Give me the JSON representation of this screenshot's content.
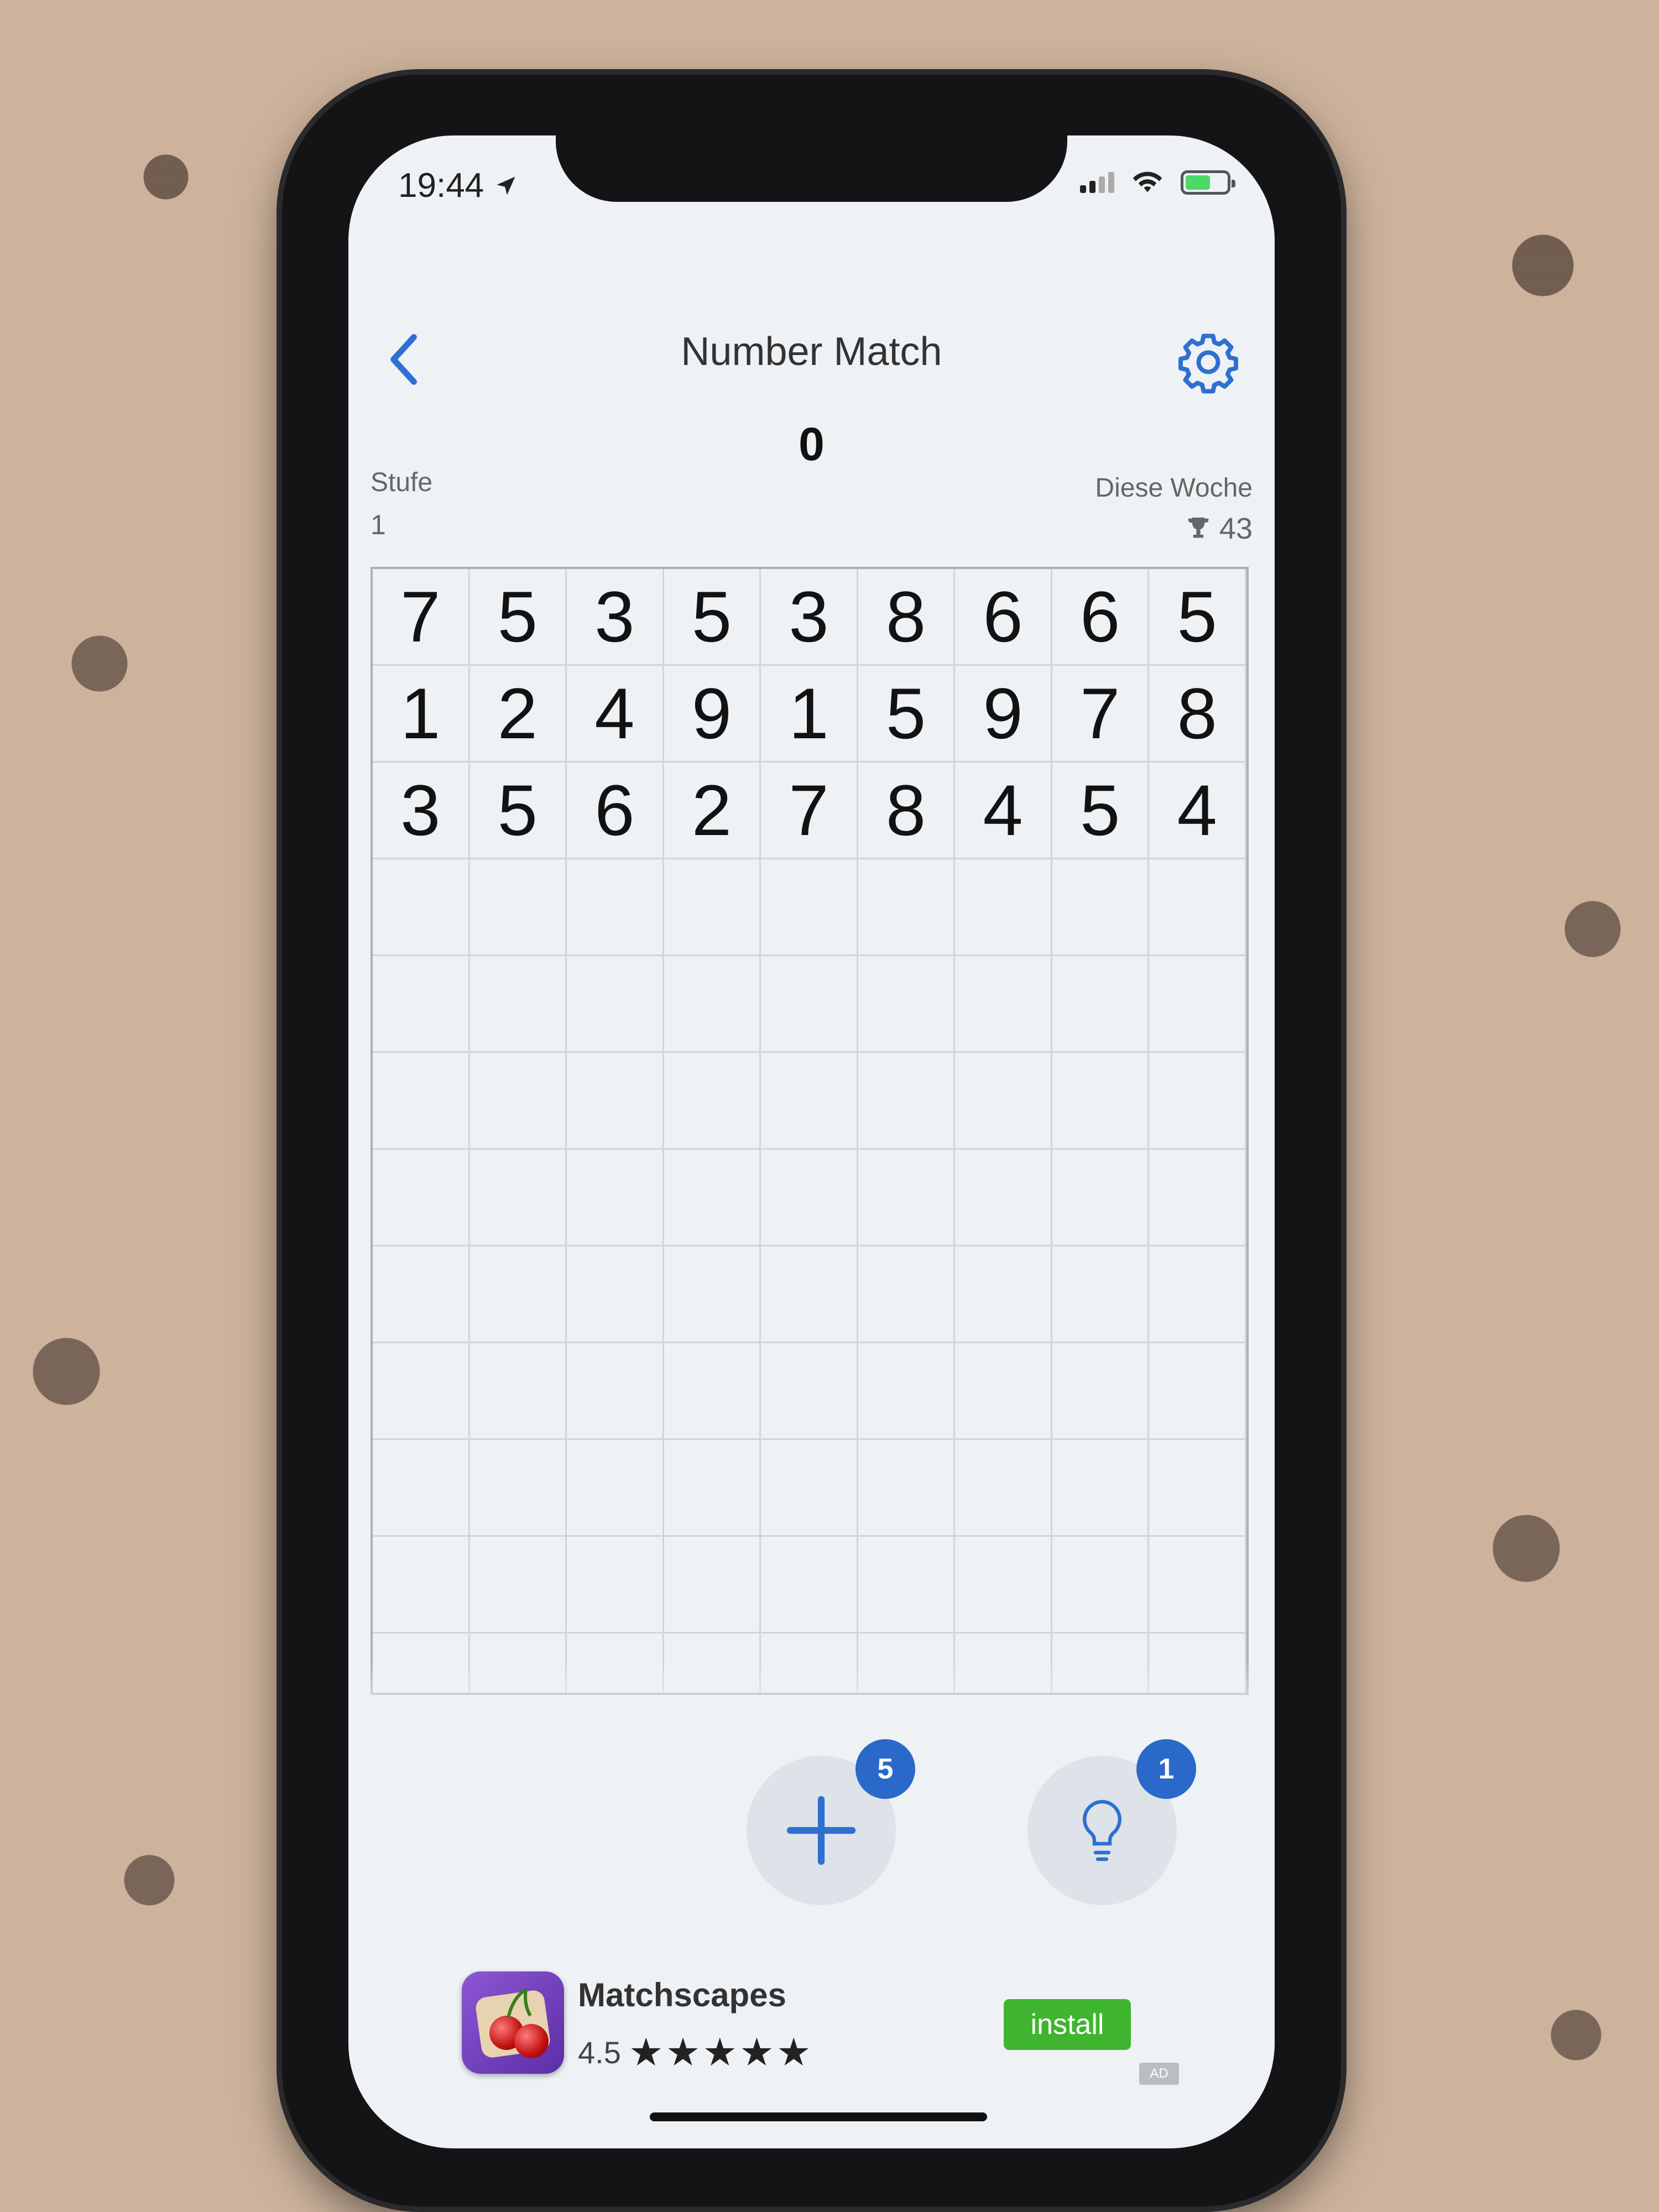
{
  "status_bar": {
    "time": "19:44"
  },
  "header": {
    "title": "Number Match",
    "score": "0"
  },
  "stats": {
    "level_label": "Stufe",
    "level_value": "1",
    "week_label": "Diese Woche",
    "week_value": "43"
  },
  "grid": {
    "rows": [
      [
        "7",
        "5",
        "3",
        "5",
        "3",
        "8",
        "6",
        "6",
        "5"
      ],
      [
        "1",
        "2",
        "4",
        "9",
        "1",
        "5",
        "9",
        "7",
        "8"
      ],
      [
        "3",
        "5",
        "6",
        "2",
        "7",
        "8",
        "4",
        "5",
        "4"
      ]
    ],
    "total_rows": 12,
    "columns": 9
  },
  "tools": {
    "add_count": "5",
    "hint_count": "1"
  },
  "ad": {
    "app_name": "Matchscapes",
    "rating": "4.5",
    "stars": "★★★★★",
    "install_label": "install",
    "tag": "AD"
  },
  "colors": {
    "accent": "#2a69c9",
    "install_green": "#3fb52f",
    "screen_bg": "#eef2f5"
  },
  "icons": [
    "location-arrow-icon",
    "signal-icon",
    "wifi-icon",
    "battery-icon",
    "back-chevron-icon",
    "gear-icon",
    "trophy-icon",
    "plus-icon",
    "lightbulb-icon",
    "star-icon"
  ]
}
